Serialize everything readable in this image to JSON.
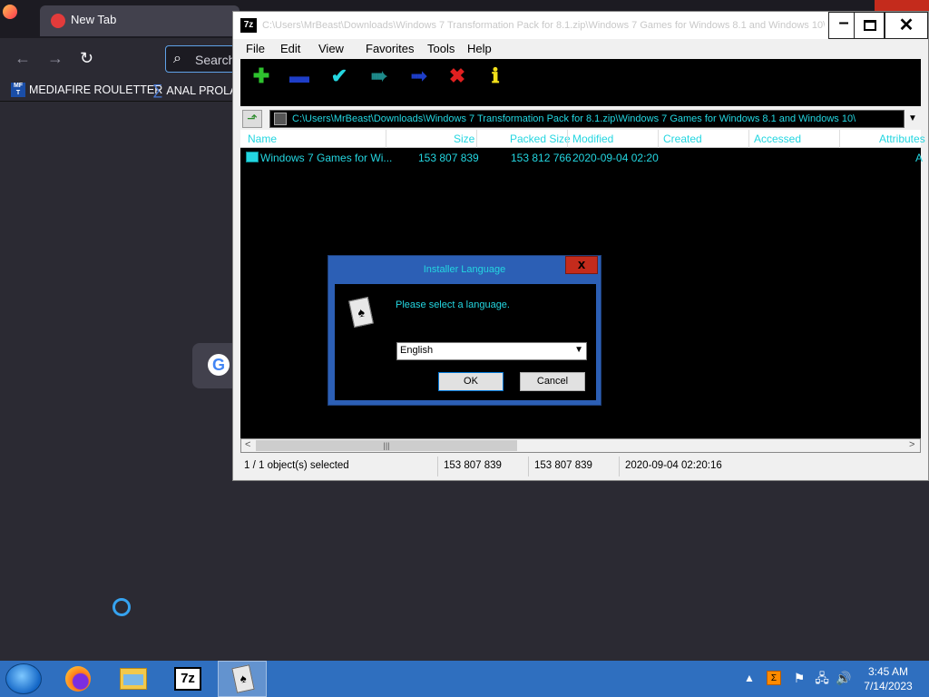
{
  "browser": {
    "tab_title": "New Tab",
    "search_placeholder": "Search",
    "bookmarks": [
      {
        "icon_text": "MF T",
        "label": "MEDIAFIRE ROULETTER"
      },
      {
        "label": "ANAL PROLA"
      }
    ],
    "nav": {
      "back": "←",
      "forward": "→",
      "reload": "↻"
    }
  },
  "zip": {
    "title": "C:\\Users\\MrBeast\\Downloads\\Windows 7 Transformation Pack for 8.1.zip\\Windows 7 Games for Windows 8.1 and Windows 10\\",
    "menu": [
      "File",
      "Edit",
      "View",
      "Favorites",
      "Tools",
      "Help"
    ],
    "address": "C:\\Users\\MrBeast\\Downloads\\Windows 7 Transformation Pack for 8.1.zip\\Windows 7 Games for Windows 8.1 and Windows 10\\",
    "columns": [
      "Name",
      "Size",
      "Packed Size",
      "Modified",
      "Created",
      "Accessed",
      "Attributes"
    ],
    "rows": [
      {
        "name": "Windows 7 Games for Wi...",
        "size": "153 807 839",
        "packed": "153 812 766",
        "modified": "2020-09-04 02:20",
        "created": "",
        "accessed": "",
        "attributes": "A"
      }
    ],
    "status": {
      "selected": "1 / 1 object(s) selected",
      "size": "153 807 839",
      "packed": "153 807 839",
      "modified": "2020-09-04 02:20:16"
    }
  },
  "dialog": {
    "title": "Installer Language",
    "message": "Please select a language.",
    "selected_language": "English",
    "ok_label": "OK",
    "cancel_label": "Cancel",
    "close_label": "x"
  },
  "taskbar": {
    "time": "3:45 AM",
    "date": "7/14/2023",
    "sevenzip_label": "7z"
  },
  "colors": {
    "accent_text": "#24d6e0",
    "dialog_frame": "#2c5fb5",
    "taskbar": "#2f6fbf"
  }
}
